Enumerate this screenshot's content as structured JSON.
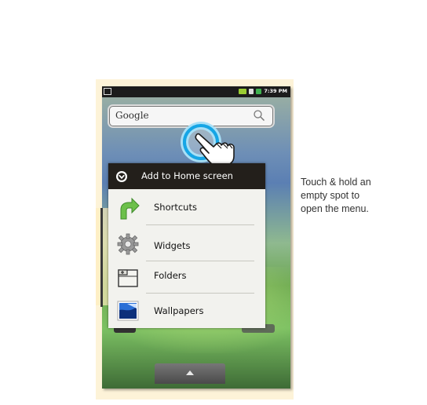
{
  "status_bar": {
    "time": "7:39 PM"
  },
  "search": {
    "label": "Google",
    "icon": "search-icon"
  },
  "menu": {
    "title": "Add to Home screen",
    "header_icon": "chevron-down-circle-icon",
    "items": [
      {
        "label": "Shortcuts",
        "icon": "shortcut-arrow-icon"
      },
      {
        "label": "Widgets",
        "icon": "gear-icon"
      },
      {
        "label": "Folders",
        "icon": "folder-icon"
      },
      {
        "label": "Wallpapers",
        "icon": "wallpaper-icon"
      }
    ]
  },
  "drawer": {
    "icon": "up-arrow-icon"
  },
  "caption": {
    "lines": [
      "Touch & hold an",
      "empty spot to",
      "open the menu."
    ]
  },
  "colors": {
    "touch_ring": "#15a6e6",
    "menu_header": "#231f1b",
    "frame": "#fdf3d8"
  }
}
